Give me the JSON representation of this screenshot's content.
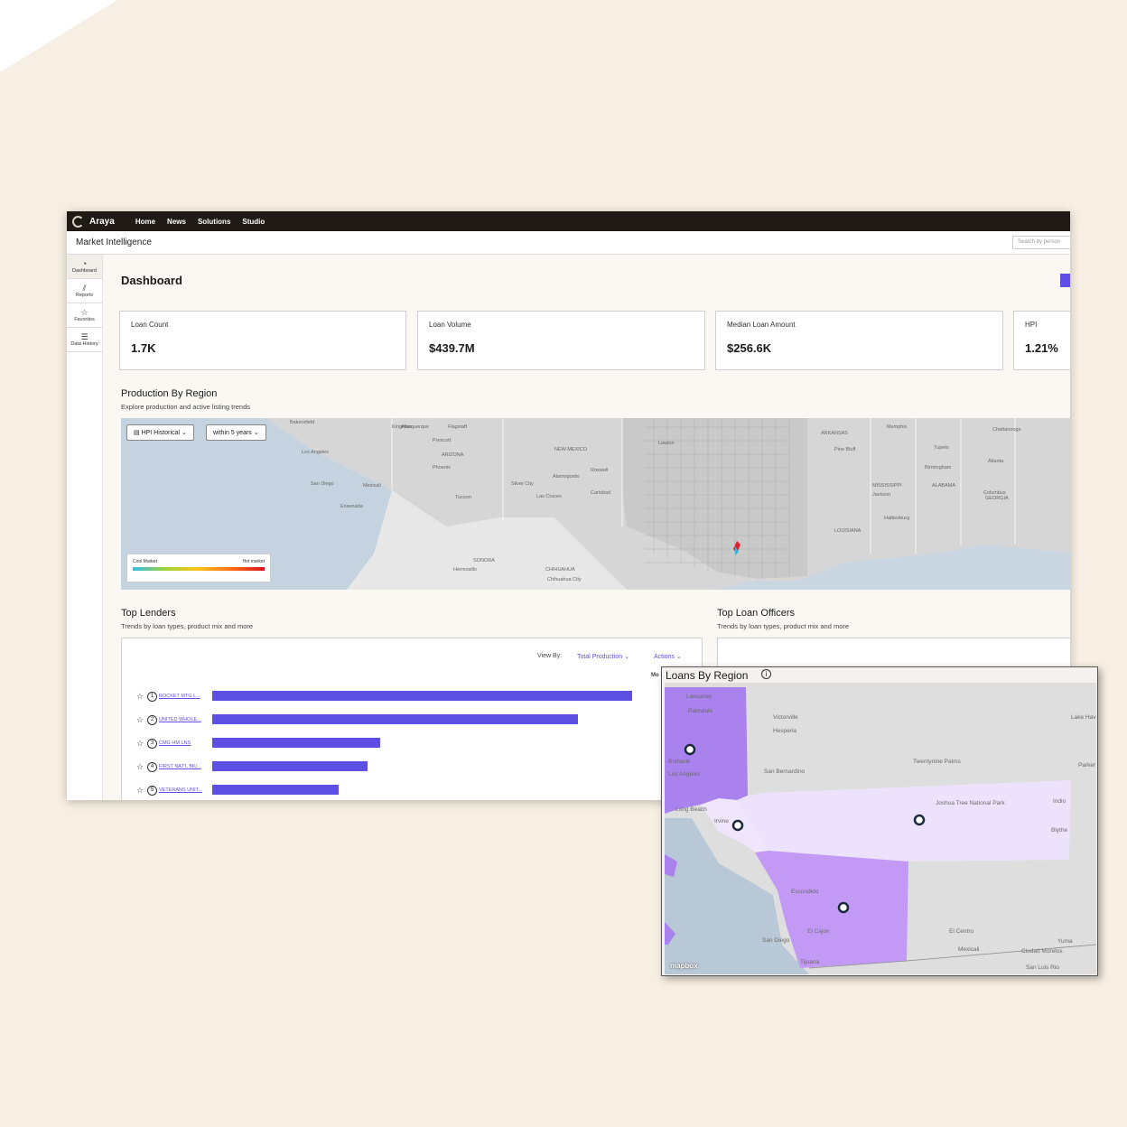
{
  "app": {
    "brand": "Araya",
    "nav": [
      "Home",
      "News",
      "Solutions",
      "Studio"
    ],
    "module_title": "Market Intelligence",
    "search_placeholder": "Search by person"
  },
  "sidebar": {
    "items": [
      {
        "label": "Dashboard",
        "icon": "gauge-icon",
        "glyph": "◔"
      },
      {
        "label": "Reports",
        "icon": "chart-icon",
        "glyph": "⫽"
      },
      {
        "label": "Favorites",
        "icon": "star-icon",
        "glyph": "☆"
      },
      {
        "label": "Data History",
        "icon": "database-icon",
        "glyph": "☰"
      }
    ]
  },
  "dashboard": {
    "title": "Dashboard",
    "kpis": [
      {
        "label": "Loan Count",
        "value": "1.7K"
      },
      {
        "label": "Loan Volume",
        "value": "$439.7M"
      },
      {
        "label": "Median Loan Amount",
        "value": "$256.6K"
      },
      {
        "label": "HPI",
        "value": "1.21%"
      }
    ]
  },
  "production": {
    "title": "Production By Region",
    "subtitle": "Explore production and active listing trends",
    "hpi_button": "HPI Historical",
    "range_button": "within 5 years",
    "legend_low": "Cool Market",
    "legend_high": "Hot market",
    "places": [
      "Los Angeles",
      "San Diego",
      "Mexicali",
      "Phoenix",
      "Tucson",
      "Albuquerque",
      "ARIZONA",
      "NEW MEXICO",
      "Prescott",
      "Flagstaff",
      "Kingman",
      "Ensenada",
      "SONORA",
      "CHIHUAHUA",
      "Hermosillo",
      "Chihuahua City",
      "Memphis",
      "ARKANSAS",
      "MISSISSIPPI",
      "ALABAMA",
      "GEORGIA",
      "LOUISIANA",
      "Jackson",
      "Atlanta",
      "Birmingham",
      "Pine Bluff",
      "Hattiesburg",
      "Columbus",
      "Chattanooga",
      "Tupelo",
      "Bakersfield",
      "Las Cruces",
      "Carlsbad",
      "Roswell",
      "Lawton",
      "Alamogordo",
      "Silver City"
    ]
  },
  "top_lenders": {
    "title": "Top Lenders",
    "subtitle": "Trends by loan types, product mix and more",
    "view_by_label": "View By:",
    "view_by_value": "Total Production ⌄",
    "actions": "Actions ⌄",
    "lenders": [
      {
        "rank": "1",
        "name": "ROCKET MTG L...",
        "value": 1.0
      },
      {
        "rank": "2",
        "name": "UNITED WHOLE...",
        "value": 0.87
      },
      {
        "rank": "3",
        "name": "CMG HM LNS",
        "value": 0.4
      },
      {
        "rank": "4",
        "name": "FIRST NAT'L BK/...",
        "value": 0.37
      },
      {
        "rank": "5",
        "name": "VETERANS UNIT...",
        "value": 0.3
      }
    ]
  },
  "top_officers": {
    "title": "Top Loan Officers",
    "subtitle": "Trends by loan types, product mix and more",
    "cut_label": "Mo"
  },
  "loans_by_region": {
    "title": "Loans By Region",
    "info_glyph": "i",
    "attribution": "mapbox",
    "places": [
      "Lancaster",
      "Palmdale",
      "Victorville",
      "Hesperia",
      "Burbank",
      "Los Angeles",
      "San Bernardino",
      "Long Beach",
      "Irvine",
      "Joshua Tree National Park",
      "Twentynine Palms",
      "Escondido",
      "El Cajon",
      "San Diego",
      "Tijuana",
      "El Centro",
      "Mexicali",
      "Yuma",
      "Ciudad Morelos",
      "San Luis Rio",
      "Lake Havasu City",
      "Parker",
      "Indio",
      "Blythe"
    ]
  },
  "colors": {
    "nav_bg": "#1f1a13",
    "accent": "#5d4fe3",
    "region_dark": "#a982ee",
    "region_light": "#ede2fb",
    "background": "#f7efe3"
  }
}
